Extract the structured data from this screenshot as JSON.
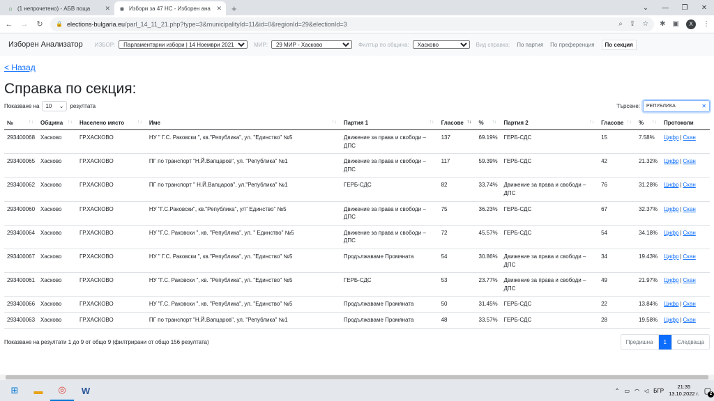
{
  "browser": {
    "tabs": [
      {
        "title": "(1 непрочетено) - АБВ поща",
        "icon": "home-icon"
      },
      {
        "title": "Избори за 47 НС - Изборен ана",
        "icon": "globe-icon"
      }
    ],
    "url_host": "elections-bulgaria.eu",
    "url_path": "/parl_14_11_21.php?type=3&municipalityId=11&id=0&regionId=29&electionId=3",
    "profile_initial": "X"
  },
  "site": {
    "brand": "Изборен Анализатор",
    "election_label": "ИЗБОР:",
    "election_value": "Парламентарни избори | 14 Ноември 2021",
    "mir_label": "МИР:",
    "mir_value": "29 МИР - Хасково",
    "filter_label": "Филтър по община:",
    "filter_value": "Хасково",
    "view_label": "Вид справка:",
    "nav": [
      "По партия",
      "По преференция",
      "По секция"
    ]
  },
  "page": {
    "back": "< Назад",
    "title": "Справка по секция:",
    "show_prefix": "Показване на",
    "show_value": "10",
    "show_suffix": "резултата",
    "search_label": "Търсене:",
    "search_value": "РЕПУБЛИКА"
  },
  "table": {
    "headers": [
      "№",
      "Община",
      "Населено място",
      "Име",
      "Партия 1",
      "Гласове",
      "%",
      "Партия 2",
      "Гласове",
      "%",
      "Протоколи"
    ],
    "rows": [
      [
        "293400068",
        "Хасково",
        "ГР.ХАСКОВО",
        "НУ \" Г.С. Раковски \", кв.\"Република\", ул. \"Единство\" №5",
        "Движение за права и свободи – ДПС",
        "137",
        "69.19%",
        "ГЕРБ-СДС",
        "15",
        "7.58%"
      ],
      [
        "293400065",
        "Хасково",
        "ГР.ХАСКОВО",
        "ПГ по транспорт \"Н.Й.Вапцаров\", ул. \"Република\" №1",
        "Движение за права и свободи – ДПС",
        "117",
        "59.39%",
        "ГЕРБ-СДС",
        "42",
        "21.32%"
      ],
      [
        "293400062",
        "Хасково",
        "ГР.ХАСКОВО",
        "ПГ по транспорт \" Н.Й.Вапцаров\", ул.\"Република\" №1",
        "ГЕРБ-СДС",
        "82",
        "33.74%",
        "Движение за права и свободи – ДПС",
        "76",
        "31.28%"
      ],
      [
        "293400060",
        "Хасково",
        "ГР.ХАСКОВО",
        "НУ \"Г.С.Раковски\", кв.\"Република\", ул\" Единство\" №5",
        "Движение за права и свободи – ДПС",
        "75",
        "36.23%",
        "ГЕРБ-СДС",
        "67",
        "32.37%"
      ],
      [
        "293400064",
        "Хасково",
        "ГР.ХАСКОВО",
        "НУ \"Г.С. Раковски \", кв. \"Република\", ул. \" Единство\" №5",
        "Движение за права и свободи – ДПС",
        "72",
        "45.57%",
        "ГЕРБ-СДС",
        "54",
        "34.18%"
      ],
      [
        "293400067",
        "Хасково",
        "ГР.ХАСКОВО",
        "НУ \" Г.С. Раковски \", кв.\"Република\", ул. \"Единство\" №5",
        "Продължаваме Промяната",
        "54",
        "30.86%",
        "Движение за права и свободи – ДПС",
        "34",
        "19.43%"
      ],
      [
        "293400061",
        "Хасково",
        "ГР.ХАСКОВО",
        "НУ \"Г.С. Раковски \", кв. \"Република\", ул. \"Единство\" №5",
        "ГЕРБ-СДС",
        "53",
        "23.77%",
        "Движение за права и свободи – ДПС",
        "49",
        "21.97%"
      ],
      [
        "293400066",
        "Хасково",
        "ГР.ХАСКОВО",
        "НУ \"Г.С. Раковски \", кв. \"Република\", ул. \"Единство\" №5",
        "Продължаваме Промяната",
        "50",
        "31.45%",
        "ГЕРБ-СДС",
        "22",
        "13.84%"
      ],
      [
        "293400063",
        "Хасково",
        "ГР.ХАСКОВО",
        "ПГ по транспорт \"Н.Й.Вапцаров\", ул. \"Република\" №1",
        "Продължаваме Промяната",
        "48",
        "33.57%",
        "ГЕРБ-СДС",
        "28",
        "19.58%"
      ]
    ],
    "protocol_links": [
      "Цифр",
      "Скан"
    ],
    "protocol_sep": "|"
  },
  "footer": {
    "info": "Показване на резултати 1 до 9 от общо 9 (филтрирани от общо 156 резултата)",
    "prev": "Предишна",
    "page": "1",
    "next": "Следваща"
  },
  "taskbar": {
    "lang": "БГР",
    "time": "21:35",
    "date": "13.10.2022 г.",
    "notifications": "2"
  }
}
